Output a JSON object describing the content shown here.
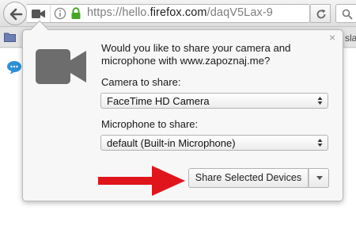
{
  "urlbar": {
    "url_prefix": "https://hello.",
    "url_domain": "firefox.com",
    "url_suffix": "/daqV5Lax-9"
  },
  "bookmarks": {
    "truncated_label": "slac"
  },
  "sharing_panel": {
    "prompt": "Would you like to share your camera and microphone with www.zapoznaj.me?",
    "close_glyph": "×",
    "camera_label": "Camera to share:",
    "camera_selected": "FaceTime HD Camera",
    "microphone_label": "Microphone to share:",
    "microphone_selected": "default (Built-in Microphone)",
    "share_button_label": "Share Selected Devices"
  },
  "icons": {
    "back": "back-arrow-icon",
    "tab_camera": "camera-icon",
    "info": "info-icon",
    "lock": "lock-icon",
    "reload": "reload-icon",
    "search": "search-icon",
    "bookmark_folder": "folder-icon",
    "chat": "chat-bubble-icon",
    "panel_camera": "camera-icon",
    "annotation": "red-arrow-icon"
  },
  "colors": {
    "lock_green": "#47a526",
    "camera_gray": "#6d6d6d",
    "annotation_red": "#e0151b",
    "chat_blue": "#2a91d6"
  }
}
